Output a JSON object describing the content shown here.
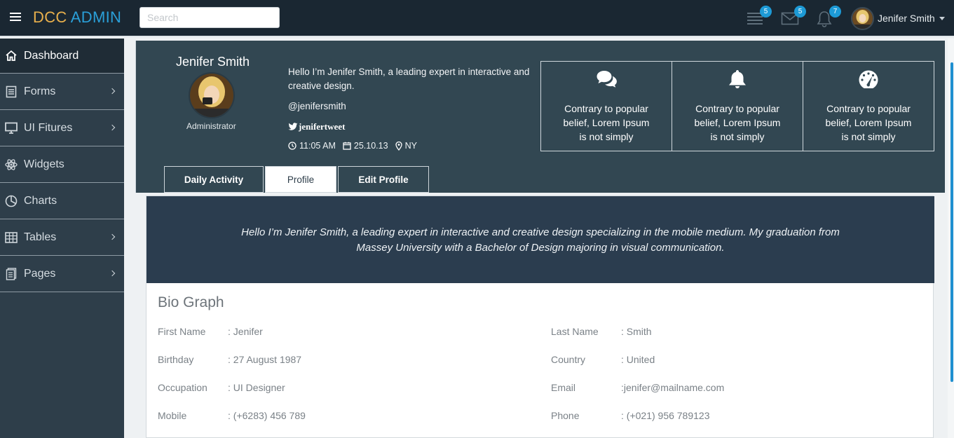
{
  "header": {
    "logo_part1": "DCC",
    "logo_part2": "ADMIN",
    "search_placeholder": "Search",
    "notifications": [
      {
        "icon": "tasks-icon",
        "count": "5"
      },
      {
        "icon": "mail-icon",
        "count": "5"
      },
      {
        "icon": "bell-icon",
        "count": "7"
      }
    ],
    "user_name": "Jenifer Smith"
  },
  "sidebar": {
    "items": [
      {
        "label": "Dashboard",
        "icon": "home-icon",
        "has_submenu": false
      },
      {
        "label": "Forms",
        "icon": "document-icon",
        "has_submenu": true
      },
      {
        "label": "UI Fitures",
        "icon": "monitor-icon",
        "has_submenu": true
      },
      {
        "label": "Widgets",
        "icon": "atom-icon",
        "has_submenu": false
      },
      {
        "label": "Charts",
        "icon": "pie-chart-icon",
        "has_submenu": false
      },
      {
        "label": "Tables",
        "icon": "table-icon",
        "has_submenu": true
      },
      {
        "label": "Pages",
        "icon": "pages-icon",
        "has_submenu": true
      }
    ]
  },
  "profile": {
    "name": "Jenifer Smith",
    "role": "Administrator",
    "intro": "Hello I’m Jenifer Smith, a leading expert in interactive and creative design.",
    "handle": "@jenifersmith",
    "twitter": "jenifertweet",
    "time": "11:05 AM",
    "date": "25.10.13",
    "location": "NY",
    "info_boxes": [
      {
        "icon": "comments-icon",
        "text": "Contrary to popular belief, Lorem Ipsum is not simply"
      },
      {
        "icon": "bell-icon",
        "text": "Contrary to popular belief, Lorem Ipsum is not simply"
      },
      {
        "icon": "dashboard-icon",
        "text": "Contrary to popular belief, Lorem Ipsum is not simply"
      }
    ]
  },
  "tabs": [
    {
      "label": "Daily Activity",
      "active": false
    },
    {
      "label": "Profile",
      "active": true
    },
    {
      "label": "Edit Profile",
      "active": false
    }
  ],
  "about": "Hello I’m Jenifer Smith, a leading expert in interactive and creative design specializing in the mobile medium. My graduation from Massey University with a Bachelor of Design majoring in visual communication.",
  "bio_graph": {
    "title": "Bio Graph",
    "fields": [
      {
        "label": "First Name",
        "value": ": Jenifer"
      },
      {
        "label": "Last Name",
        "value": ": Smith"
      },
      {
        "label": "Birthday",
        "value": ": 27 August 1987"
      },
      {
        "label": "Country",
        "value": ": United"
      },
      {
        "label": "Occupation",
        "value": ": UI Designer"
      },
      {
        "label": "Email",
        "value": ":jenifer@mailname.com"
      },
      {
        "label": "Mobile",
        "value": ": (+6283) 456 789"
      },
      {
        "label": "Phone",
        "value": ": (+021) 956 789123"
      }
    ]
  }
}
